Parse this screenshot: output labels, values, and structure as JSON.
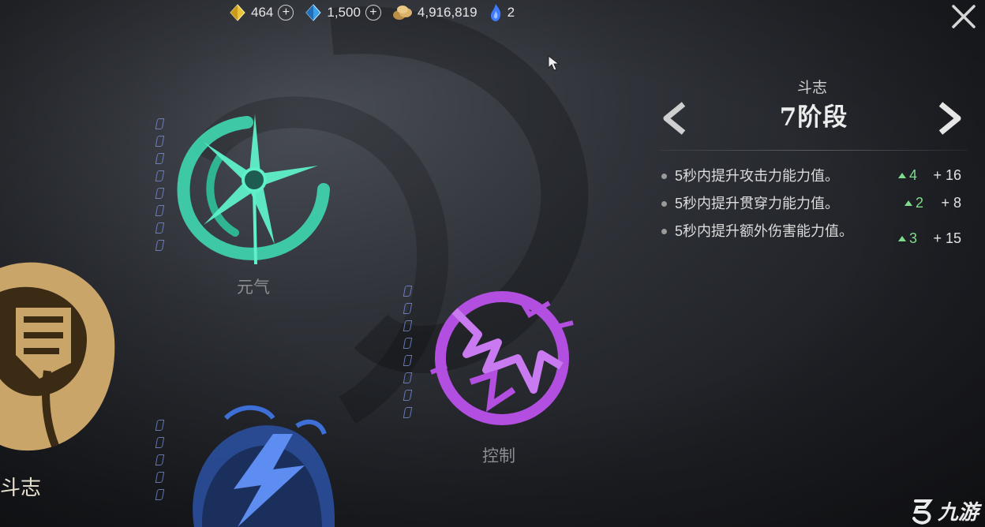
{
  "currencies": [
    {
      "name": "gold-gem",
      "icon": "yellow-diamond-icon",
      "value": "464",
      "has_plus": true,
      "color": "#e8c33a"
    },
    {
      "name": "blue-gem",
      "icon": "blue-diamond-icon",
      "value": "1,500",
      "has_plus": true,
      "color": "#3aa0e8"
    },
    {
      "name": "coins",
      "icon": "coin-pile-icon",
      "value": "4,916,819",
      "has_plus": false,
      "color": "#d9b36a"
    },
    {
      "name": "flame",
      "icon": "blue-flame-icon",
      "value": "2",
      "has_plus": false,
      "color": "#3f7bff"
    }
  ],
  "panel": {
    "subtitle": "斗志",
    "title": "7阶段",
    "stats": [
      {
        "text": "5秒内提升攻击力能力值。",
        "up": "4",
        "value": "+ 16"
      },
      {
        "text": "5秒内提升贯穿力能力值。",
        "up": "2",
        "value": "+ 8"
      },
      {
        "text": "5秒内提升额外伤害能力值。",
        "up": "3",
        "value": "+ 15"
      }
    ]
  },
  "nodes": {
    "yuanqi": {
      "label": "元气",
      "color": "#3fd8b0"
    },
    "kongzhi": {
      "label": "控制",
      "color": "#b24fe0"
    },
    "lightning": {
      "label": "",
      "color": "#3d6fd6"
    },
    "douzhi": {
      "label": "斗志",
      "color": "#c9a56a"
    }
  },
  "watermark": {
    "text": "九游"
  },
  "colors": {
    "accent_green": "#7fdc8c",
    "background": "#2f3238"
  }
}
